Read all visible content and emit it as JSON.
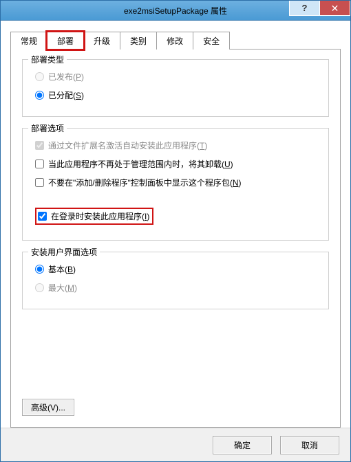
{
  "titlebar": {
    "title": "exe2msiSetupPackage 属性",
    "help_label": "?",
    "close_label": "✕"
  },
  "tabs": [
    {
      "label": "常规"
    },
    {
      "label": "部署"
    },
    {
      "label": "升级"
    },
    {
      "label": "类别"
    },
    {
      "label": "修改"
    },
    {
      "label": "安全"
    }
  ],
  "deploy_type": {
    "legend": "部署类型",
    "published": {
      "label": "已发布(",
      "accel": "P",
      "suffix": ")"
    },
    "assigned": {
      "label": "已分配(",
      "accel": "S",
      "suffix": ")"
    }
  },
  "deploy_opts": {
    "legend": "部署选项",
    "autoinstall": {
      "label": "通过文件扩展名激活自动安装此应用程序(",
      "accel": "T",
      "suffix": ")"
    },
    "uninstall": {
      "label": "当此应用程序不再处于管理范围内时，将其卸载(",
      "accel": "U",
      "suffix": ")"
    },
    "hidearp": {
      "label": "不要在\"添加/删除程序\"控制面板中显示这个程序包(",
      "accel": "N",
      "suffix": ")"
    },
    "logon": {
      "label": "在登录时安装此应用程序(",
      "accel": "I",
      "suffix": ")"
    }
  },
  "ui_opts": {
    "legend": "安装用户界面选项",
    "basic": {
      "label": "基本(",
      "accel": "B",
      "suffix": ")"
    },
    "max": {
      "label": "最大(",
      "accel": "M",
      "suffix": ")"
    }
  },
  "buttons": {
    "advanced": "高级(V)...",
    "ok": "确定",
    "cancel": "取消"
  }
}
